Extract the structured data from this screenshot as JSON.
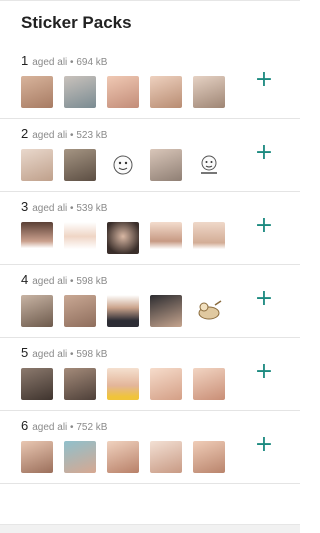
{
  "header": {
    "title": "Sticker Packs"
  },
  "packs": [
    {
      "number": "1",
      "meta": "aged ali • 694 kB"
    },
    {
      "number": "2",
      "meta": "aged ali • 523 kB"
    },
    {
      "number": "3",
      "meta": "aged ali • 539 kB"
    },
    {
      "number": "4",
      "meta": "aged ali • 598 kB"
    },
    {
      "number": "5",
      "meta": "aged ali • 598 kB"
    },
    {
      "number": "6",
      "meta": "aged ali • 752 kB"
    }
  ],
  "add_icon": "plus-icon",
  "colors": {
    "accent": "#1c8a80",
    "divider": "#e4e4e4"
  }
}
